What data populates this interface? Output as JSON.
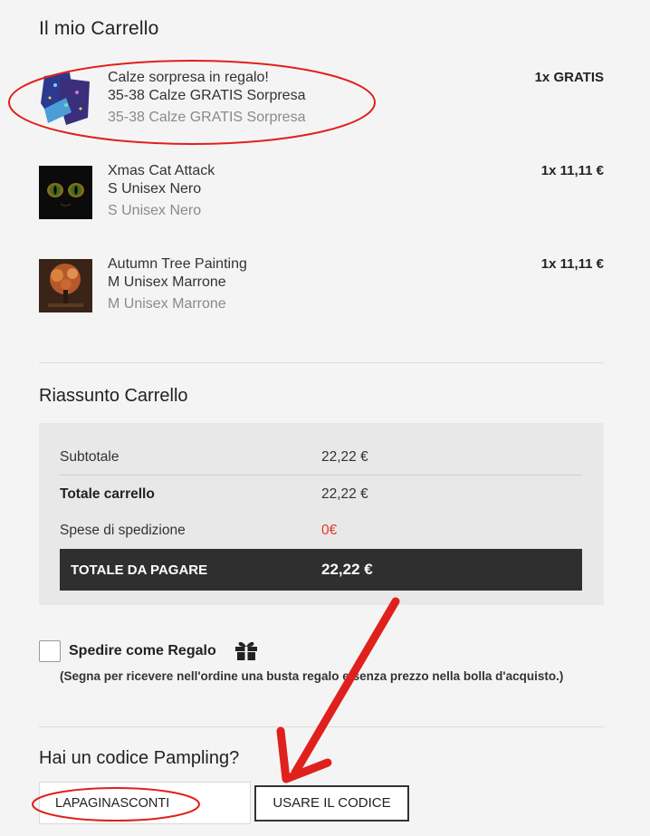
{
  "cart": {
    "title": "Il mio Carrello",
    "items": [
      {
        "name": "Calze sorpresa in regalo!",
        "variant": "35-38 Calze GRATIS Sorpresa",
        "variant_sub": "35-38 Calze GRATIS Sorpresa",
        "price": "1x GRATIS"
      },
      {
        "name": "Xmas Cat Attack",
        "variant": "S Unisex Nero",
        "variant_sub": "S Unisex Nero",
        "price": "1x 11,11 €"
      },
      {
        "name": "Autumn Tree Painting",
        "variant": "M Unisex Marrone",
        "variant_sub": "M Unisex Marrone",
        "price": "1x 11,11 €"
      }
    ]
  },
  "summary": {
    "title": "Riassunto Carrello",
    "subtotal_label": "Subtotale",
    "subtotal_value": "22,22 €",
    "cart_total_label": "Totale carrello",
    "cart_total_value": "22,22 €",
    "shipping_label": "Spese di spedizione",
    "shipping_value": "0€",
    "pay_total_label": "TOTALE DA PAGARE",
    "pay_total_value": "22,22 €"
  },
  "gift": {
    "label": "Spedire come Regalo",
    "note": "(Segna per ricevere nell'ordine una busta regalo e senza prezzo nella bolla d'acquisto.)",
    "checked": false,
    "icon": "gift-icon"
  },
  "coupon": {
    "title": "Hai un codice Pampling?",
    "value": "LAPAGINASCONTI",
    "button_label": "USARE IL CODICE"
  },
  "colors": {
    "annotation": "#e0201c",
    "shipping_free": "#e43a2b",
    "total_bar": "#2f2f2f"
  }
}
